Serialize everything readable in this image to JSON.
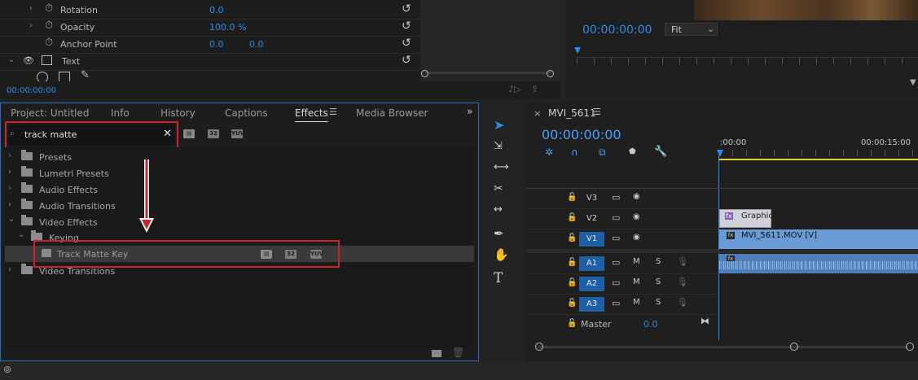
{
  "effect_controls": {
    "rows": [
      {
        "label": "Rotation",
        "v1": "0.0",
        "v2": ""
      },
      {
        "label": "Opacity",
        "v1": "100.0 %",
        "v2": ""
      },
      {
        "label": "Anchor Point",
        "v1": "0.0",
        "v2": "0.0"
      }
    ],
    "text_label": "Text",
    "timecode": "00:00:00:00"
  },
  "program": {
    "timecode": "00:00:00:00",
    "fit": "Fit"
  },
  "effects_panel": {
    "tabs": [
      "Project: Untitled",
      "Info",
      "History",
      "Captions",
      "Effects",
      "Media Browser"
    ],
    "active_tab": "Effects",
    "search_value": "track matte",
    "badges": [
      "32",
      "YUV"
    ],
    "tree": [
      {
        "name": "Presets"
      },
      {
        "name": "Lumetri Presets"
      },
      {
        "name": "Audio Effects"
      },
      {
        "name": "Audio Transitions"
      },
      {
        "name": "Video Effects"
      },
      {
        "name": "Keying"
      },
      {
        "name": "Track Matte Key"
      },
      {
        "name": "Video Transitions"
      }
    ]
  },
  "timeline": {
    "sequence": "MVI_5611",
    "timecode": "00:00:00:00",
    "ruler": [
      ":00:00",
      "00:00:15:00"
    ],
    "tracks": [
      {
        "name": "V3",
        "on": false
      },
      {
        "name": "V2",
        "on": false
      },
      {
        "name": "V1",
        "on": true
      },
      {
        "name": "A1",
        "on": true
      },
      {
        "name": "A2",
        "on": true
      },
      {
        "name": "A3",
        "on": true
      }
    ],
    "master_label": "Master",
    "master_value": "0.0",
    "clips": {
      "graphic": "Graphic",
      "video": "MVI_5611.MOV [V]"
    },
    "ms": {
      "m": "M",
      "s": "S"
    }
  },
  "colors": {
    "accent": "#2d8ceb",
    "highlight": "#c9262c",
    "clip_video": "#6b9bd6",
    "clip_graphic": "#d0d0d8"
  }
}
